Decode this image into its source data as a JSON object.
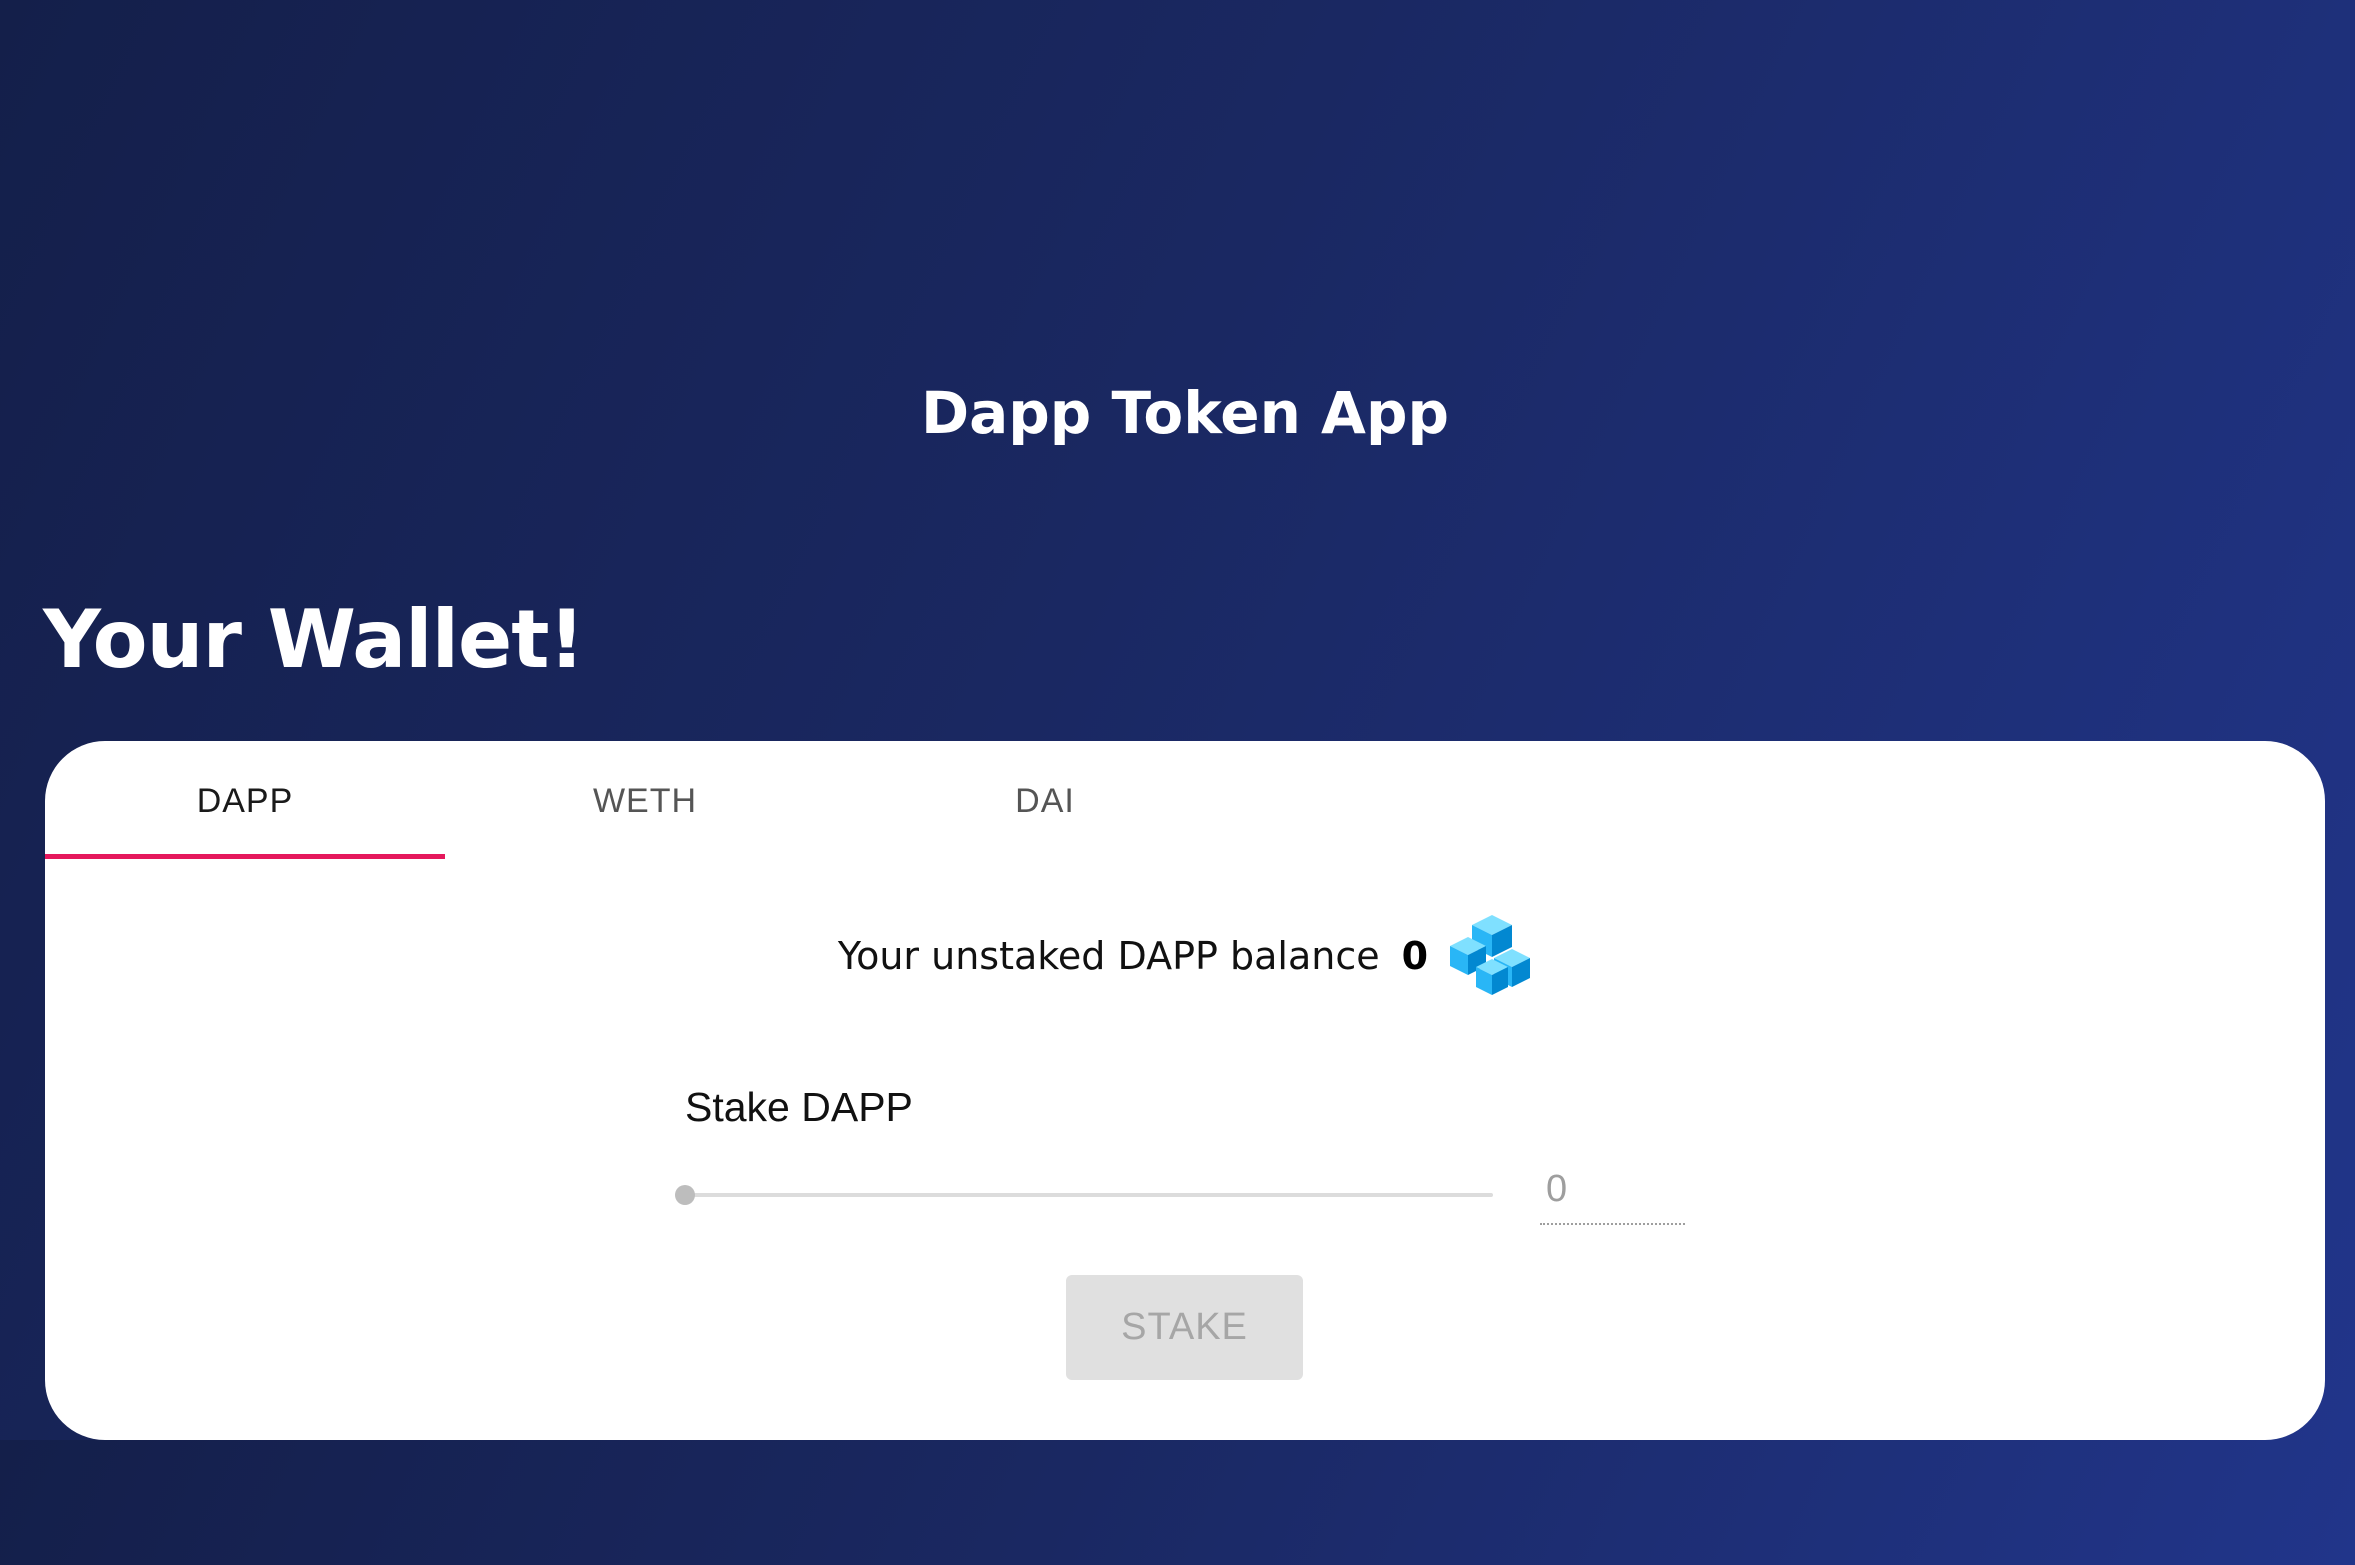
{
  "app": {
    "title": "Dapp Token App"
  },
  "wallet": {
    "heading": "Your Wallet!",
    "tabs": [
      {
        "label": "DAPP",
        "active": true
      },
      {
        "label": "WETH",
        "active": false
      },
      {
        "label": "DAI",
        "active": false
      }
    ],
    "balance_label": "Your unstaked DAPP balance",
    "balance_value": "0",
    "token_icon": "dapp-token-cubes-icon",
    "stake": {
      "label": "Stake DAPP",
      "slider_value": 0,
      "slider_max": 0,
      "amount_value": "0",
      "button_label": "STAKE",
      "button_disabled": true
    }
  },
  "colors": {
    "background_start": "#141f4a",
    "background_end": "#21358a",
    "tab_indicator": "#e5185c",
    "card": "#ffffff",
    "disabled_button_bg": "#e0e0e0",
    "disabled_button_text": "#a6a6a6",
    "token_icon": "#29b6f6"
  }
}
